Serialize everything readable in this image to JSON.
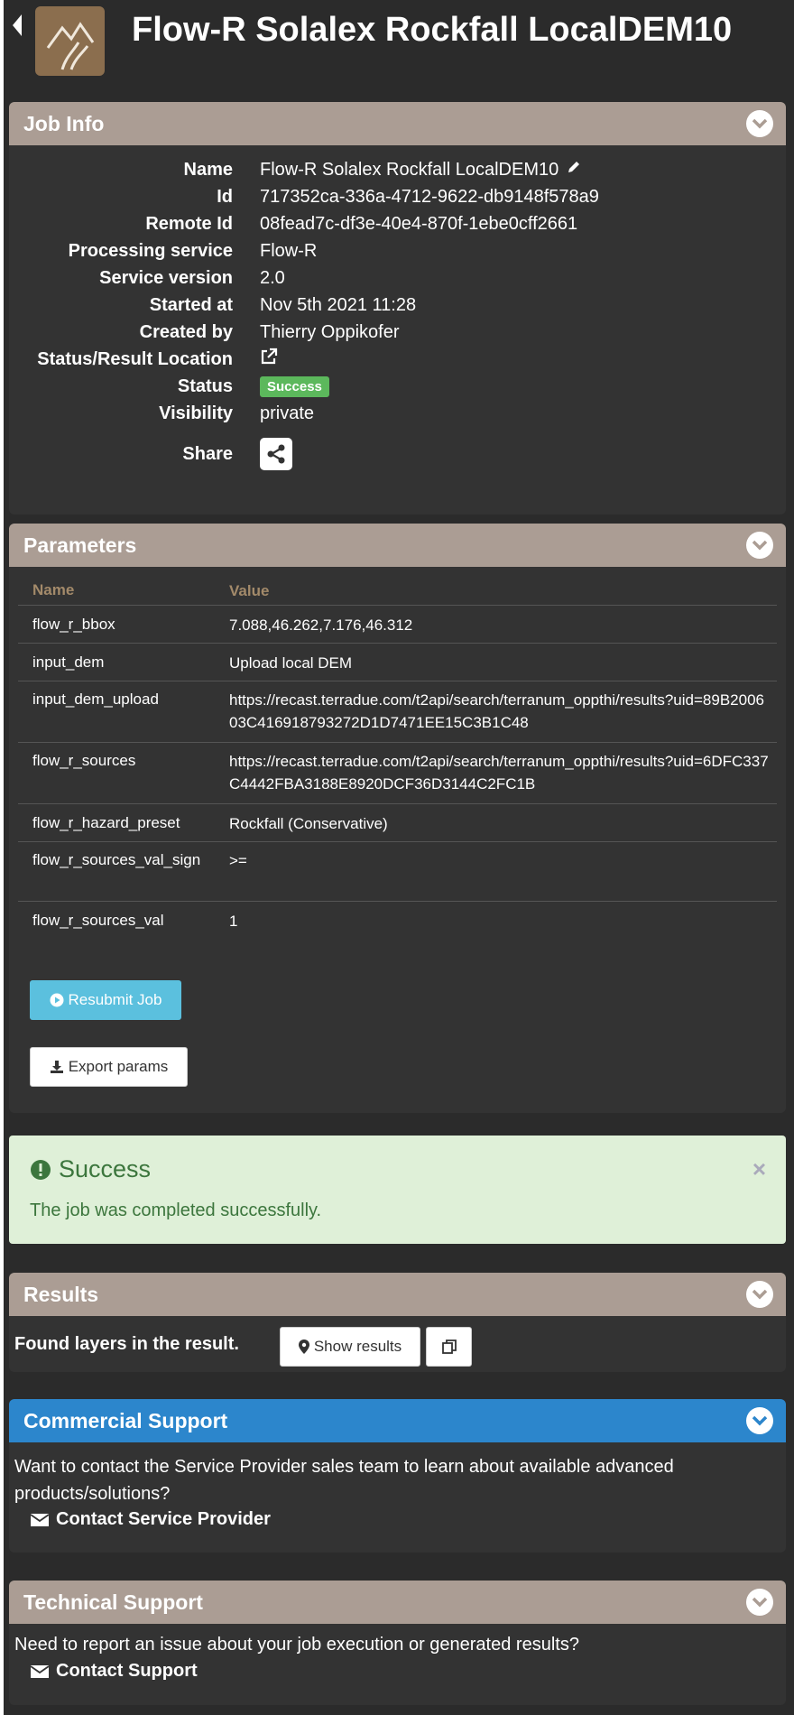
{
  "header": {
    "title": "Flow-R Solalex Rockfall LocalDEM10"
  },
  "job_info": {
    "panel_title": "Job Info",
    "rows": [
      {
        "key": "Name",
        "value": "Flow-R Solalex Rockfall LocalDEM10"
      },
      {
        "key": "Id",
        "value": "717352ca-336a-4712-9622-db9148f578a9"
      },
      {
        "key": "Remote Id",
        "value": "08fead7c-df3e-40e4-870f-1ebe0cff2661"
      },
      {
        "key": "Processing service",
        "value": "Flow-R"
      },
      {
        "key": "Service version",
        "value": "2.0"
      },
      {
        "key": "Started at",
        "value": "Nov 5th 2021 11:28"
      },
      {
        "key": "Created by",
        "value": "Thierry Oppikofer"
      },
      {
        "key": "Status/Result Location",
        "value": ""
      },
      {
        "key": "Status",
        "value": "Success"
      },
      {
        "key": "Visibility",
        "value": "private"
      },
      {
        "key": "Share",
        "value": ""
      }
    ]
  },
  "parameters": {
    "panel_title": "Parameters",
    "col_name": "Name",
    "col_value": "Value",
    "rows": [
      {
        "name": "flow_r_bbox",
        "value": "7.088,46.262,7.176,46.312"
      },
      {
        "name": "input_dem",
        "value": "Upload local DEM"
      },
      {
        "name": "input_dem_upload",
        "value": "https://recast.terradue.com/t2api/search/terranum_oppthi/results?uid=89B200603C416918793272D1D7471EE15C3B1C48"
      },
      {
        "name": "flow_r_sources",
        "value": "https://recast.terradue.com/t2api/search/terranum_oppthi/results?uid=6DFC337C4442FBA3188E8920DCF36D3144C2FC1B"
      },
      {
        "name": "flow_r_hazard_preset",
        "value": "Rockfall (Conservative)"
      },
      {
        "name": "flow_r_sources_val_sign",
        "value": ">="
      },
      {
        "name": "flow_r_sources_val",
        "value": "1"
      }
    ],
    "resubmit_label": "Resubmit Job",
    "export_label": "Export params"
  },
  "alert": {
    "title": "Success",
    "message": "The job was completed successfully.",
    "close": "×"
  },
  "results": {
    "panel_title": "Results",
    "text": "Found layers in the result.",
    "show_label": "Show results"
  },
  "commercial": {
    "panel_title": "Commercial Support",
    "text": "Want to contact the Service Provider sales team to learn about available advanced products/solutions?",
    "link": "Contact Service Provider"
  },
  "technical": {
    "panel_title": "Technical Support",
    "text": "Need to report an issue about your job execution or generated results?",
    "link": "Contact Support"
  },
  "colors": {
    "panel_header": "#ab9d94",
    "commercial_header": "#2c86cc",
    "success": "#5cb85c",
    "info_button": "#5bc0de",
    "alert_bg": "#dff0d8"
  }
}
